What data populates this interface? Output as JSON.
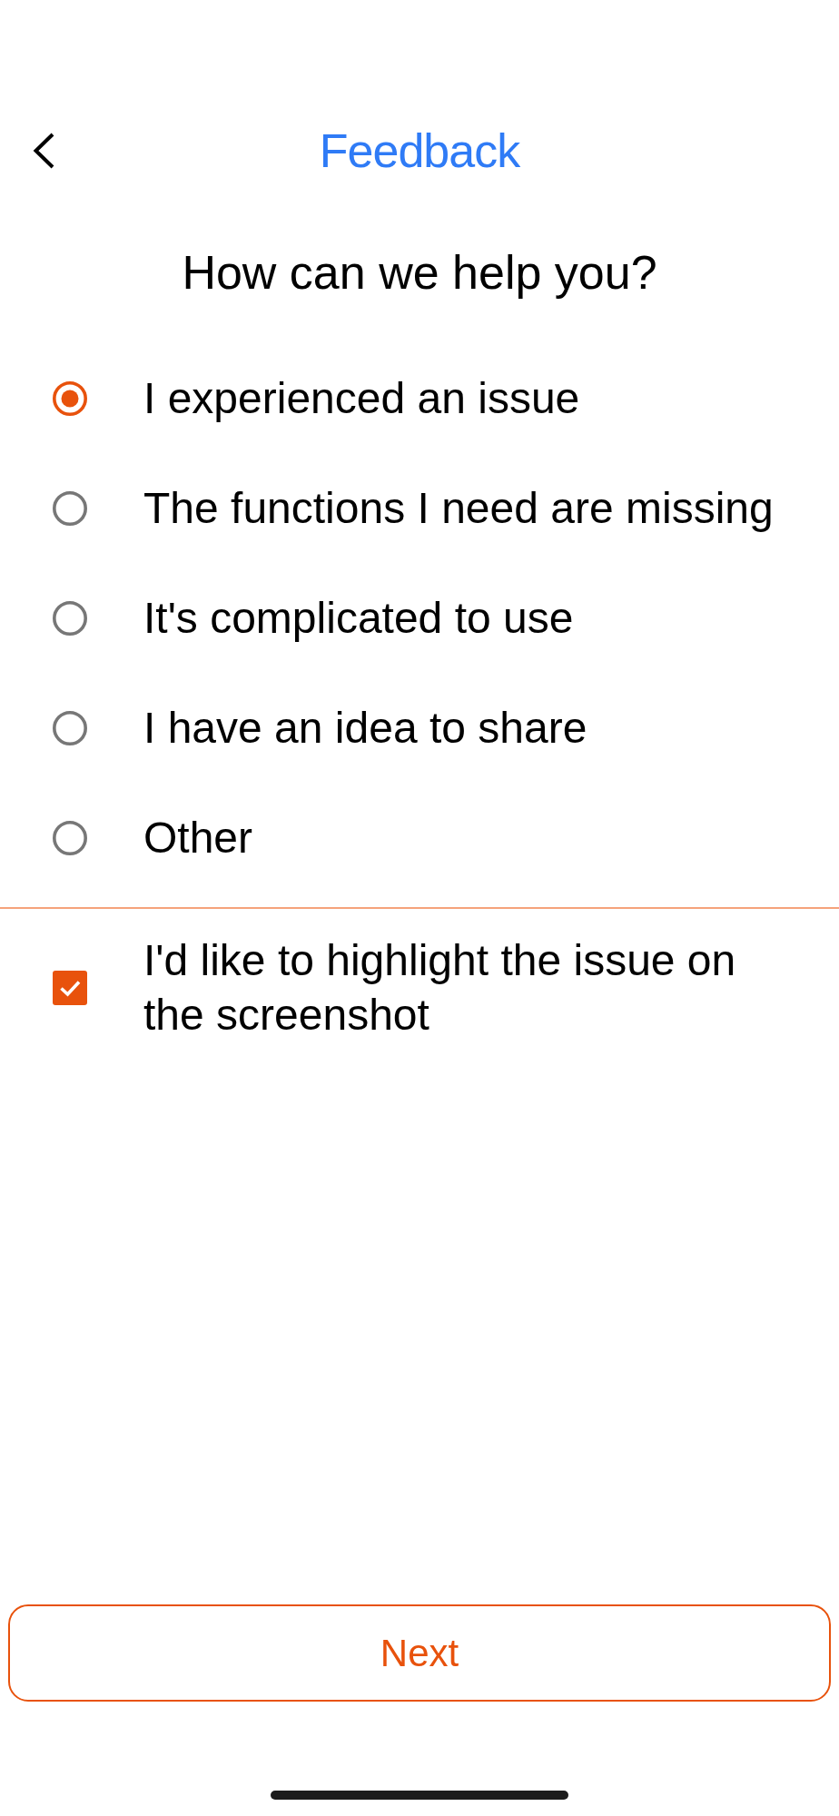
{
  "header": {
    "title": "Feedback"
  },
  "question": "How can we help you?",
  "options": [
    {
      "label": "I experienced an issue",
      "selected": true
    },
    {
      "label": "The functions I need are missing",
      "selected": false
    },
    {
      "label": "It's complicated to use",
      "selected": false
    },
    {
      "label": "I have an idea to share",
      "selected": false
    },
    {
      "label": "Other",
      "selected": false
    }
  ],
  "highlight_option": {
    "label": "I'd like to highlight the issue on the screenshot",
    "checked": true
  },
  "next_button": {
    "label": "Next"
  }
}
